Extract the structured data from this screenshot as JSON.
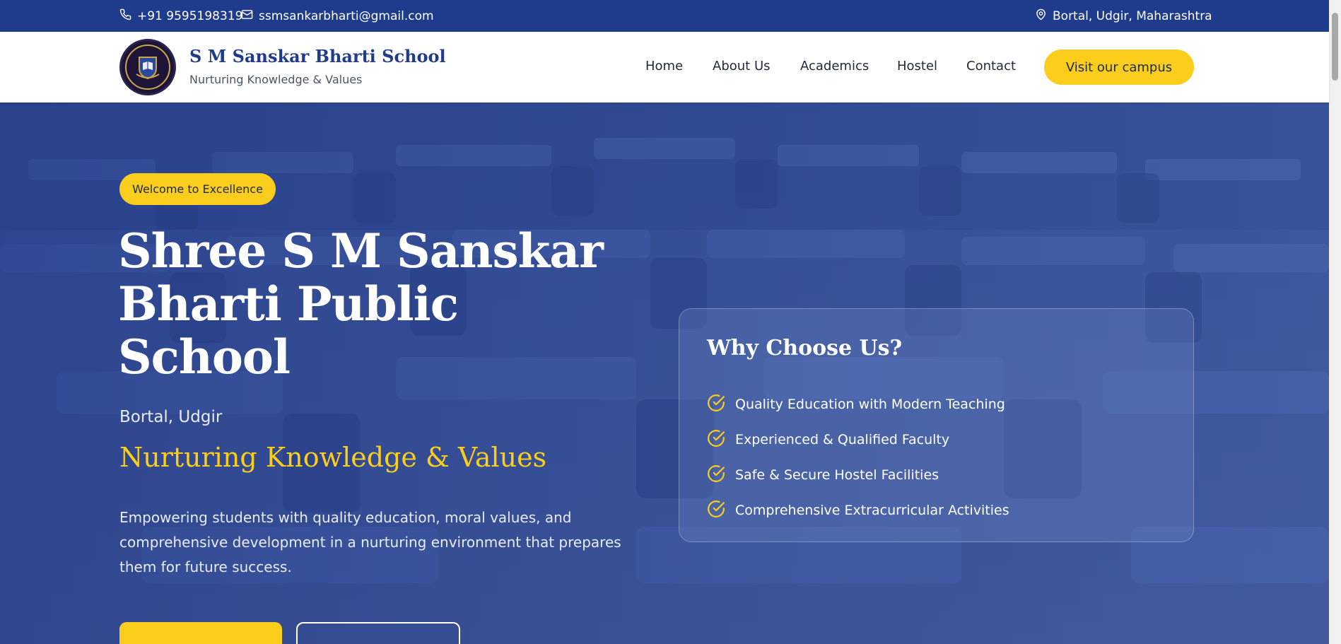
{
  "topbar": {
    "phone": "+91 9595198319",
    "email": "ssmsankarbharti@gmail.com",
    "location": "Bortal, Udgir, Maharashtra",
    "icons": [
      "phone-icon",
      "mail-icon",
      "map-pin-icon"
    ]
  },
  "header": {
    "brand_name": "S M Sanskar Bharti School",
    "brand_tagline": "Nurturing Knowledge & Values",
    "nav": [
      "Home",
      "About Us",
      "Academics",
      "Hostel",
      "Contact"
    ],
    "cta": "Visit our campus"
  },
  "hero": {
    "badge": "Welcome to Excellence",
    "title": "Shree S M Sanskar Bharti Public School",
    "location": "Bortal, Udgir",
    "motto": "Nurturing Knowledge & Values",
    "description": "Empowering students with quality education, moral values, and comprehensive development in a nurturing environment that prepares them for future success."
  },
  "why_card": {
    "title": "Why Choose Us?",
    "items": [
      "Quality Education with Modern Teaching",
      "Experienced & Qualified Faculty",
      "Safe & Secure Hostel Facilities",
      "Comprehensive Extracurricular Activities"
    ]
  },
  "colors": {
    "primary": "#1f3b8c",
    "accent": "#fbcd1c",
    "white": "#ffffff"
  }
}
